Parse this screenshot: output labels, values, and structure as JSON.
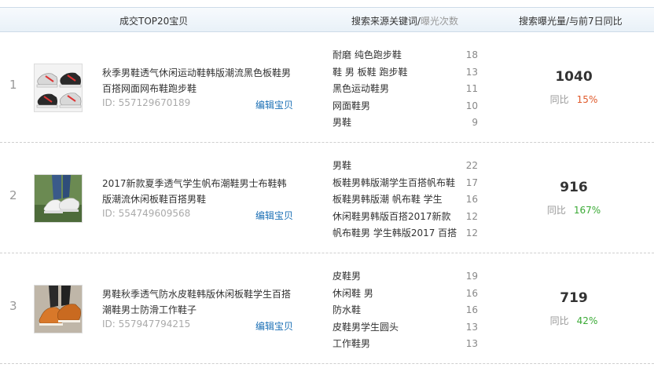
{
  "header": {
    "product": "成交TOP20宝贝",
    "keywords_main": "搜索来源关键词/",
    "keywords_sub": "曝光次数",
    "exposure": "搜索曝光量/与前7日同比"
  },
  "rows": [
    {
      "rank": "1",
      "title": "秋季男鞋透气休闲运动鞋韩版潮流黑色板鞋男百搭网面网布鞋跑步鞋",
      "id": "ID: 557129670189",
      "edit": "编辑宝贝",
      "keywords": [
        {
          "k": "耐磨 纯色跑步鞋",
          "n": "18"
        },
        {
          "k": "鞋 男 板鞋 跑步鞋",
          "n": "13"
        },
        {
          "k": "黑色运动鞋男",
          "n": "11"
        },
        {
          "k": "网面鞋男",
          "n": "10"
        },
        {
          "k": "男鞋",
          "n": "9"
        }
      ],
      "exposure": "1040",
      "cmp_label": "同比",
      "cmp_value": "15%",
      "cmp_color": "#e05a2b"
    },
    {
      "rank": "2",
      "title": "2017新款夏季透气学生帆布潮鞋男士布鞋韩版潮流休闲板鞋百搭男鞋",
      "id": "ID: 554749609568",
      "edit": "编辑宝贝",
      "keywords": [
        {
          "k": "男鞋",
          "n": "22"
        },
        {
          "k": "板鞋男韩版潮学生百搭帆布鞋",
          "n": "17"
        },
        {
          "k": "板鞋男韩版潮 帆布鞋 学生",
          "n": "16"
        },
        {
          "k": "休闲鞋男韩版百搭2017新款",
          "n": "12"
        },
        {
          "k": "帆布鞋男 学生韩版2017 百搭",
          "n": "12"
        }
      ],
      "exposure": "916",
      "cmp_label": "同比",
      "cmp_value": "167%",
      "cmp_color": "#3aaa35"
    },
    {
      "rank": "3",
      "title": "男鞋秋季透气防水皮鞋韩版休闲板鞋学生百搭潮鞋男士防滑工作鞋子",
      "id": "ID: 557947794215",
      "edit": "编辑宝贝",
      "keywords": [
        {
          "k": "皮鞋男",
          "n": "19"
        },
        {
          "k": "休闲鞋 男",
          "n": "16"
        },
        {
          "k": "防水鞋",
          "n": "16"
        },
        {
          "k": "皮鞋男学生圆头",
          "n": "13"
        },
        {
          "k": "工作鞋男",
          "n": "13"
        }
      ],
      "exposure": "719",
      "cmp_label": "同比",
      "cmp_value": "42%",
      "cmp_color": "#3aaa35"
    }
  ]
}
